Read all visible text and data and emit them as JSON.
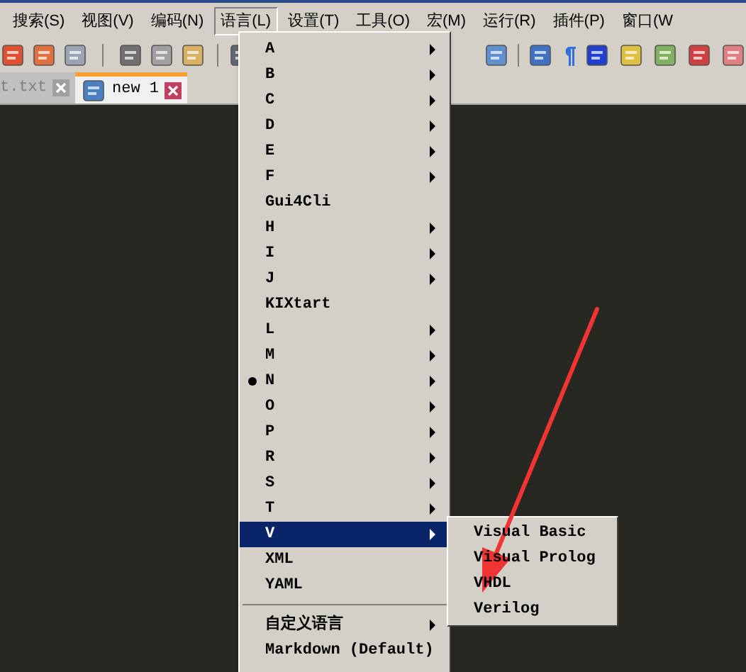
{
  "menubar": [
    {
      "label": "搜索(S)",
      "selected": false
    },
    {
      "label": "视图(V)",
      "selected": false
    },
    {
      "label": "编码(N)",
      "selected": false
    },
    {
      "label": "语言(L)",
      "selected": true
    },
    {
      "label": "设置(T)",
      "selected": false
    },
    {
      "label": "工具(O)",
      "selected": false
    },
    {
      "label": "宏(M)",
      "selected": false
    },
    {
      "label": "运行(R)",
      "selected": false
    },
    {
      "label": "插件(P)",
      "selected": false
    },
    {
      "label": "窗口(W",
      "selected": false
    }
  ],
  "tabs": [
    {
      "label": "t.txt",
      "selected": false
    },
    {
      "label": "new 1",
      "selected": true
    }
  ],
  "language_menu": [
    {
      "kind": "submenu",
      "label": "A",
      "checked": false,
      "selected": false
    },
    {
      "kind": "submenu",
      "label": "B",
      "checked": false,
      "selected": false
    },
    {
      "kind": "submenu",
      "label": "C",
      "checked": false,
      "selected": false
    },
    {
      "kind": "submenu",
      "label": "D",
      "checked": false,
      "selected": false
    },
    {
      "kind": "submenu",
      "label": "E",
      "checked": false,
      "selected": false
    },
    {
      "kind": "submenu",
      "label": "F",
      "checked": false,
      "selected": false
    },
    {
      "kind": "item",
      "label": "Gui4Cli",
      "checked": false,
      "selected": false
    },
    {
      "kind": "submenu",
      "label": "H",
      "checked": false,
      "selected": false
    },
    {
      "kind": "submenu",
      "label": "I",
      "checked": false,
      "selected": false
    },
    {
      "kind": "submenu",
      "label": "J",
      "checked": false,
      "selected": false
    },
    {
      "kind": "item",
      "label": "KIXtart",
      "checked": false,
      "selected": false
    },
    {
      "kind": "submenu",
      "label": "L",
      "checked": false,
      "selected": false
    },
    {
      "kind": "submenu",
      "label": "M",
      "checked": false,
      "selected": false
    },
    {
      "kind": "submenu",
      "label": "N",
      "checked": true,
      "selected": false
    },
    {
      "kind": "submenu",
      "label": "O",
      "checked": false,
      "selected": false
    },
    {
      "kind": "submenu",
      "label": "P",
      "checked": false,
      "selected": false
    },
    {
      "kind": "submenu",
      "label": "R",
      "checked": false,
      "selected": false
    },
    {
      "kind": "submenu",
      "label": "S",
      "checked": false,
      "selected": false
    },
    {
      "kind": "submenu",
      "label": "T",
      "checked": false,
      "selected": false
    },
    {
      "kind": "submenu",
      "label": "V",
      "checked": false,
      "selected": true
    },
    {
      "kind": "item",
      "label": "XML",
      "checked": false,
      "selected": false
    },
    {
      "kind": "item",
      "label": "YAML",
      "checked": false,
      "selected": false
    },
    {
      "kind": "separator"
    },
    {
      "kind": "submenu",
      "label": "自定义语言",
      "checked": false,
      "selected": false
    },
    {
      "kind": "item",
      "label": "Markdown (Default)",
      "checked": false,
      "selected": false
    }
  ],
  "v_submenu": [
    {
      "label": "Visual Basic"
    },
    {
      "label": "Visual Prolog"
    },
    {
      "label": "VHDL"
    },
    {
      "label": "Verilog"
    }
  ]
}
